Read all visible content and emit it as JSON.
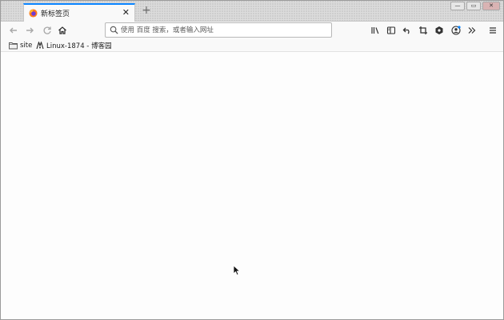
{
  "tab": {
    "title": "新标签页",
    "close_glyph": "✕",
    "favicon": "firefox-icon"
  },
  "new_tab_glyph": "+",
  "window_controls": {
    "minimize": "—",
    "maximize": "▭",
    "close": "✕"
  },
  "nav": {
    "back_icon": "back-arrow-icon",
    "forward_icon": "forward-arrow-icon",
    "reload_icon": "reload-icon",
    "home_icon": "home-icon"
  },
  "urlbar": {
    "placeholder": "使用 百度 搜索，或者输入网址",
    "value": ""
  },
  "toolbar_icons": [
    "library-icon",
    "sidebar-icon",
    "undo-icon",
    "crop-icon",
    "extension-icon",
    "account-icon",
    "overflow-icon",
    "menu-icon"
  ],
  "bookmarks": {
    "items": [
      {
        "label": "site",
        "icon": "folder-icon"
      },
      {
        "label": "Linux-1874 - 博客园",
        "icon": "blog-favicon"
      }
    ]
  },
  "colors": {
    "accent": "#0a84ff",
    "tab_strip": "#dcdcdc",
    "content_bg": "#fdfdfd"
  }
}
